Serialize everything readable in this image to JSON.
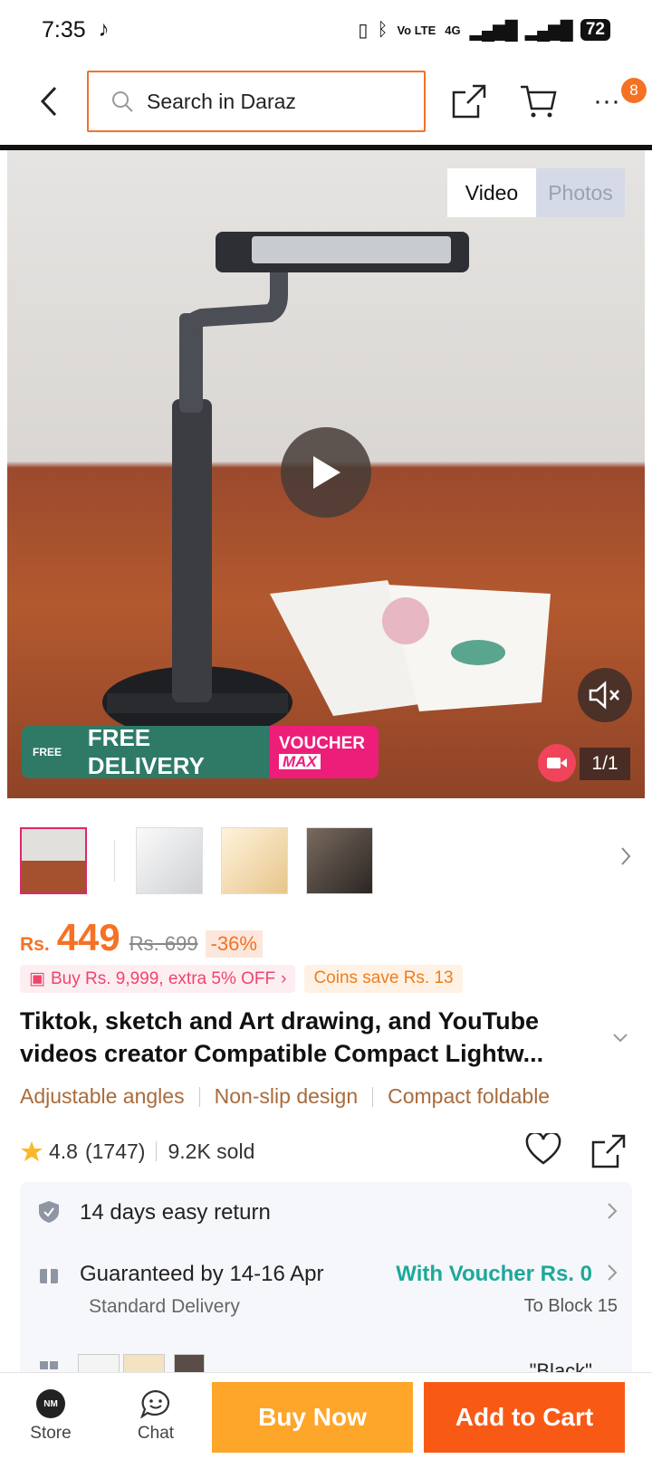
{
  "status_bar": {
    "time": "7:35",
    "app_icon": "tiktok-icon",
    "indicators": [
      "vibrate-icon",
      "bluetooth-icon",
      "Vo LTE",
      "4G",
      "signal-icon",
      "signal-icon"
    ],
    "battery": "72"
  },
  "header": {
    "search_placeholder": "Search in Daraz",
    "more_badge": "8"
  },
  "media": {
    "tabs": [
      {
        "label": "Video",
        "active": true
      },
      {
        "label": "Photos",
        "active": false
      }
    ],
    "delivery_badge": "FREE DELIVERY",
    "delivery_truck_text": "FREE",
    "voucher_top": "VOUCHER",
    "voucher_bottom": "MAX",
    "counter": "1/1"
  },
  "product": {
    "currency": "Rs.",
    "price": "449",
    "original_price": "Rs. 699",
    "discount": "-36%",
    "promo": "Buy Rs. 9,999, extra 5% OFF",
    "coins": "Coins save Rs. 13",
    "title": "Tiktok, sketch and Art drawing, and YouTube videos creator Compatible Compact Lightw...",
    "features": [
      "Adjustable angles",
      "Non-slip design",
      "Compact foldable"
    ],
    "rating": "4.8",
    "reviews": "(1747)",
    "sold": "9.2K sold"
  },
  "info": {
    "return_policy": "14 days easy return",
    "guarantee": "Guaranteed by 14-16 Apr",
    "voucher_text": "With Voucher Rs. 0",
    "delivery_type": "Standard Delivery",
    "location": "To Block 15",
    "variant_value": "\"Black\""
  },
  "bottom_bar": {
    "store_label": "Store",
    "store_logo_text": "NM",
    "chat_label": "Chat",
    "buy_now": "Buy Now",
    "add_to_cart": "Add to Cart"
  },
  "colors": {
    "accent": "#f57224",
    "buy_now": "#fea62a",
    "add_to_cart": "#f85a16",
    "feature_text": "#a86b3c",
    "voucher_green": "#1ca99a"
  }
}
